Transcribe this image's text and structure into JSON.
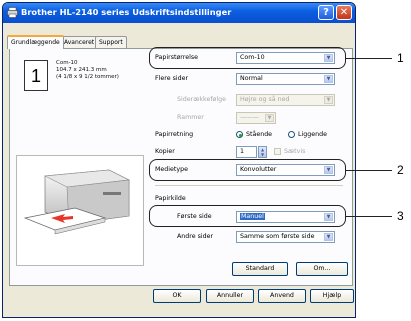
{
  "window": {
    "title": "Brother HL-2140 series Udskriftsindstillinger",
    "help_glyph": "?",
    "close_glyph": "✕"
  },
  "tabs": [
    {
      "label": "Grundlæggende",
      "active": true
    },
    {
      "label": "Avanceret",
      "active": false
    },
    {
      "label": "Support",
      "active": false
    }
  ],
  "paper_info": {
    "number": "1",
    "name": "Com-10",
    "size_mm": "104.7 x 241.3 mm",
    "size_in": "(4 1/8 x 9 1/2 tommer)"
  },
  "fields": {
    "paper_size": {
      "label": "Papirstørrelse",
      "value": "Com-10"
    },
    "multiple_pages": {
      "label": "Flere sider",
      "value": "Normal"
    },
    "page_order": {
      "label": "Siderækkefølge",
      "value": "Højre og så ned"
    },
    "border": {
      "label": "Rammer",
      "value": "———"
    },
    "orientation": {
      "label": "Papirretning",
      "option1": "Stående",
      "option2": "Liggende"
    },
    "copies": {
      "label": "Kopier",
      "value": "1",
      "collate_label": "Sætvis"
    },
    "media_type": {
      "label": "Medietype",
      "value": "Konvolutter"
    },
    "paper_source": {
      "label": "Papirkilde"
    },
    "first_page": {
      "label": "Første side",
      "value": "Manuel"
    },
    "other_pages": {
      "label": "Andre sider",
      "value": "Samme som første side"
    }
  },
  "panel_buttons": {
    "default": "Standard",
    "about": "Om..."
  },
  "dialog_buttons": {
    "ok": "OK",
    "cancel": "Annuller",
    "apply": "Anvend",
    "help": "Hjælp"
  },
  "callouts": {
    "one": "1",
    "two": "2",
    "three": "3"
  },
  "colors": {
    "title_bar": "#0b5fe0",
    "selection": "#316ac5",
    "dialog_bg": "#ece9d8"
  }
}
